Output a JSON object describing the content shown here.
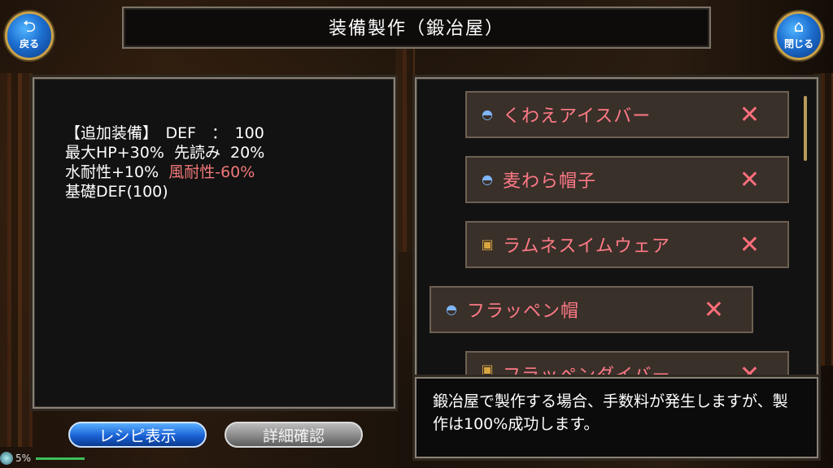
{
  "header": {
    "title": "装備製作（鍛冶屋）"
  },
  "nav": {
    "back_icon": "return-arrow-icon",
    "back_label": "戻る",
    "close_icon": "home-icon",
    "close_label": "閉じる"
  },
  "info": {
    "line1": "【追加装備】　DEF　：　100",
    "line2": "最大HP+30%  先読み  20%",
    "line3_a": "水耐性+10%  ",
    "line3_b": "風耐性-60%",
    "line4": "基礎DEF(100)"
  },
  "equipment_list": {
    "items": [
      {
        "name": "くわえアイスバー",
        "icon": "hat-icon",
        "remove_label": "✕"
      },
      {
        "name": "麦わら帽子",
        "icon": "hat-icon",
        "remove_label": "✕"
      },
      {
        "name": "ラムネスイムウェア",
        "icon": "armor-icon",
        "remove_label": "✕"
      },
      {
        "name": "フラッペン帽",
        "icon": "hat-icon",
        "remove_label": "✕"
      },
      {
        "name": "フラッペンダイバー",
        "icon": "armor-icon",
        "remove_label": "✕"
      }
    ]
  },
  "message": {
    "text": "鍛冶屋で製作する場合、手数料が発生しますが、製作は100%成功します。"
  },
  "buttons": {
    "recipe_label": "レシピ表示",
    "details_label": "詳細確認"
  },
  "status": {
    "battery": "5%"
  },
  "colors": {
    "accent_blue": "#1d6fd0",
    "negative_text": "#f07878",
    "item_name": "#ff7a86"
  }
}
